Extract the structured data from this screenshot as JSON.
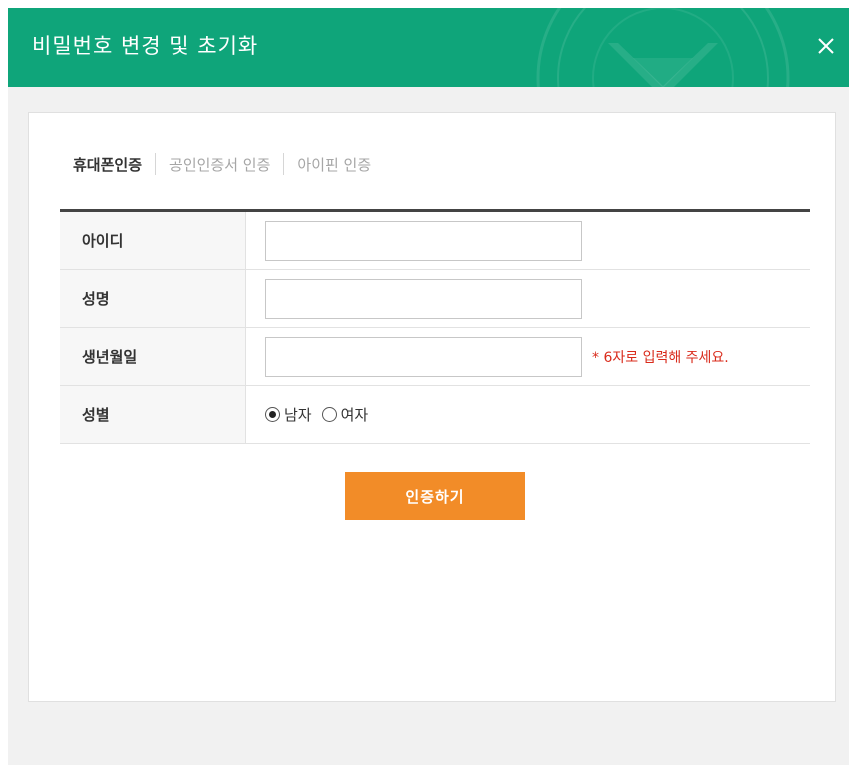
{
  "header": {
    "title": "비밀번호 변경 및 초기화",
    "close_icon": "close-icon",
    "background_color": "#0fa57a"
  },
  "tabs": [
    {
      "label": "휴대폰인증",
      "active": true
    },
    {
      "label": "공인인증서 인증",
      "active": false
    },
    {
      "label": "아이핀 인증",
      "active": false
    }
  ],
  "form": {
    "fields": [
      {
        "label": "아이디",
        "value": "",
        "placeholder": ""
      },
      {
        "label": "성명",
        "value": "",
        "placeholder": ""
      },
      {
        "label": "생년월일",
        "value": "",
        "placeholder": "",
        "hint": "* 6자로 입력해 주세요."
      }
    ],
    "gender": {
      "label": "성별",
      "options": [
        {
          "label": "남자",
          "selected": true
        },
        {
          "label": "여자",
          "selected": false
        }
      ]
    }
  },
  "submit": {
    "label": "인증하기",
    "color": "#f28c28"
  },
  "colors": {
    "accent_green": "#0fa57a",
    "button_orange": "#f28c28",
    "hint_red": "#d92b1b"
  }
}
